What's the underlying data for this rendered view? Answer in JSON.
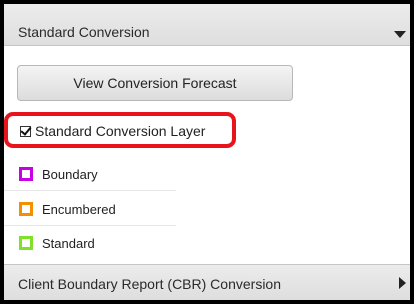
{
  "sections": {
    "standard": {
      "title": "Standard Conversion",
      "icon": "caret-down-icon"
    },
    "cbr": {
      "title": "Client Boundary Report (CBR) Conversion",
      "icon": "caret-right-icon"
    }
  },
  "forecast_button": {
    "label": "View Conversion Forecast"
  },
  "layer": {
    "label": "Standard Conversion Layer",
    "checked": true,
    "highlight_color": "#e8141c"
  },
  "legend": [
    {
      "label": "Boundary",
      "color": "#c800e6"
    },
    {
      "label": "Encumbered",
      "color": "#f29000"
    },
    {
      "label": "Standard",
      "color": "#7fe12a"
    }
  ]
}
